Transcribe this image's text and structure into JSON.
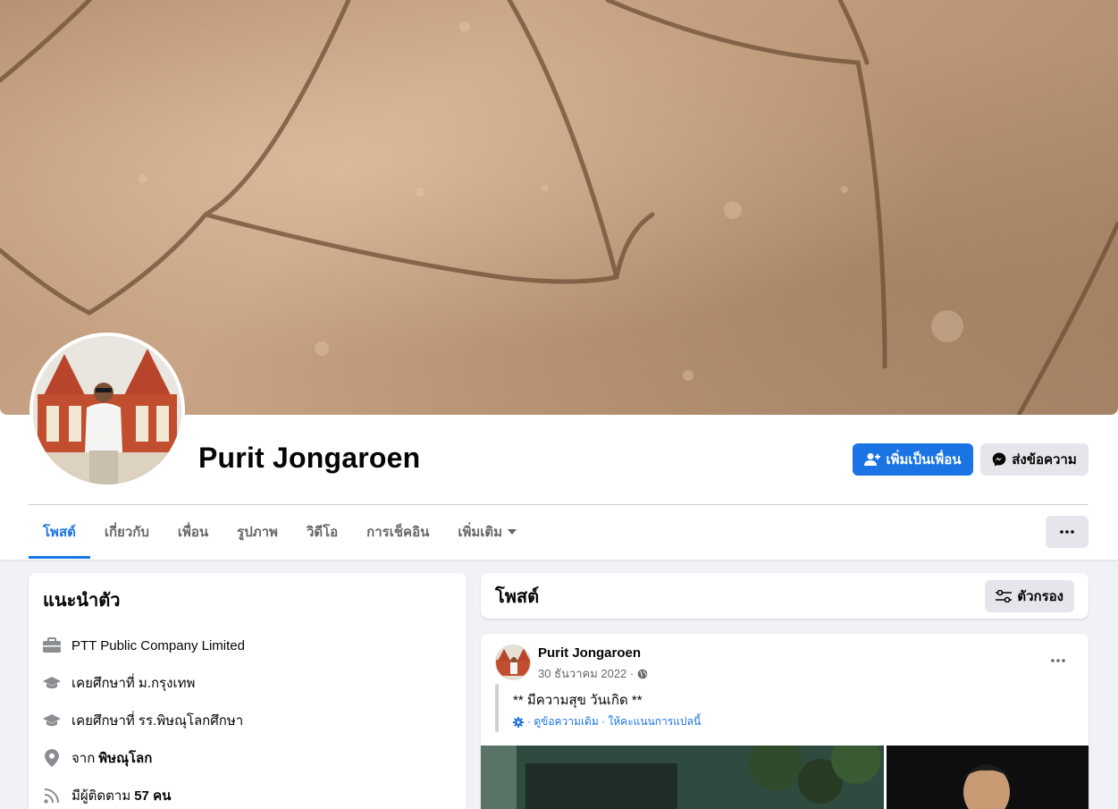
{
  "profile": {
    "name": "Purit Jongaroen",
    "add_friend_label": "เพิ่มเป็นเพื่อน",
    "message_label": "ส่งข้อความ"
  },
  "tabs": [
    {
      "label": "โพสต์"
    },
    {
      "label": "เกี่ยวกับ"
    },
    {
      "label": "เพื่อน"
    },
    {
      "label": "รูปภาพ"
    },
    {
      "label": "วิดีโอ"
    },
    {
      "label": "การเช็คอิน"
    },
    {
      "label": "เพิ่มเติม"
    }
  ],
  "intro": {
    "title": "แนะนำตัว",
    "work": "PTT Public Company Limited",
    "education_1": "เคยศึกษาที่ ม.กรุงเทพ",
    "education_2": "เคยศึกษาที่ รร.พิษณุโลกศึกษา",
    "from_prefix": "จาก",
    "from_place": "พิษณุโลก",
    "followers_prefix": "มีผู้ติดตาม",
    "followers_count": "57 คน"
  },
  "posts_section": {
    "title": "โพสต์",
    "filter_label": "ตัวกรอง"
  },
  "post": {
    "author": "Purit Jongaroen",
    "date": "30 ธันวาคม 2022 ·",
    "text": "** มีความสุข วันเกิด **",
    "translate_text": "· ดูข้อความเดิม · ให้คะแนนการแปลนี้"
  },
  "colors": {
    "accent": "#1b74e4",
    "page_bg": "#f0f2f5",
    "secondary_button": "#e4e6eb",
    "secondary_text": "#65676b"
  }
}
